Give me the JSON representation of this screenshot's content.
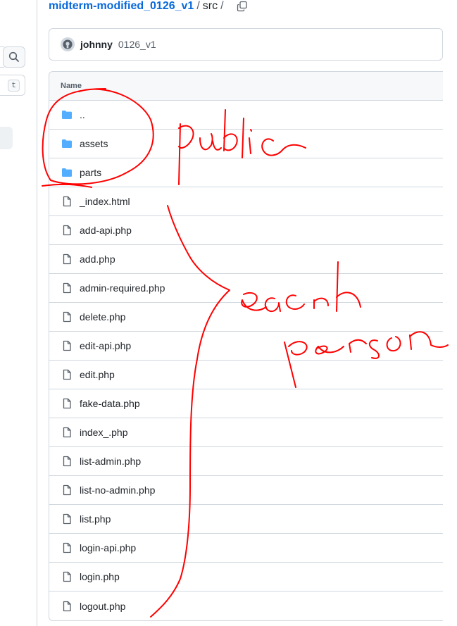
{
  "breadcrumb": {
    "repo": "midterm-modified_0126_v1",
    "sep1": "/",
    "dir": "src",
    "sep2": "/"
  },
  "sidebar": {
    "filter_shortcut": "t"
  },
  "commit": {
    "author": "johnny",
    "message": "0126_v1"
  },
  "table": {
    "header": "Name",
    "rows": [
      {
        "name": "..",
        "type": "folder"
      },
      {
        "name": "assets",
        "type": "folder"
      },
      {
        "name": "parts",
        "type": "folder"
      },
      {
        "name": "_index.html",
        "type": "file"
      },
      {
        "name": "add-api.php",
        "type": "file"
      },
      {
        "name": "add.php",
        "type": "file"
      },
      {
        "name": "admin-required.php",
        "type": "file"
      },
      {
        "name": "delete.php",
        "type": "file"
      },
      {
        "name": "edit-api.php",
        "type": "file"
      },
      {
        "name": "edit.php",
        "type": "file"
      },
      {
        "name": "fake-data.php",
        "type": "file"
      },
      {
        "name": "index_.php",
        "type": "file"
      },
      {
        "name": "list-admin.php",
        "type": "file"
      },
      {
        "name": "list-no-admin.php",
        "type": "file"
      },
      {
        "name": "list.php",
        "type": "file"
      },
      {
        "name": "login-api.php",
        "type": "file"
      },
      {
        "name": "login.php",
        "type": "file"
      },
      {
        "name": "logout.php",
        "type": "file"
      }
    ]
  },
  "colors": {
    "link": "#0969da",
    "folder": "#54aeff",
    "border": "#d0d7de",
    "annotation": "#ff0000"
  },
  "icons": {
    "folder": "folder-icon",
    "file": "file-icon",
    "copy": "copy-icon",
    "search": "search-icon"
  }
}
